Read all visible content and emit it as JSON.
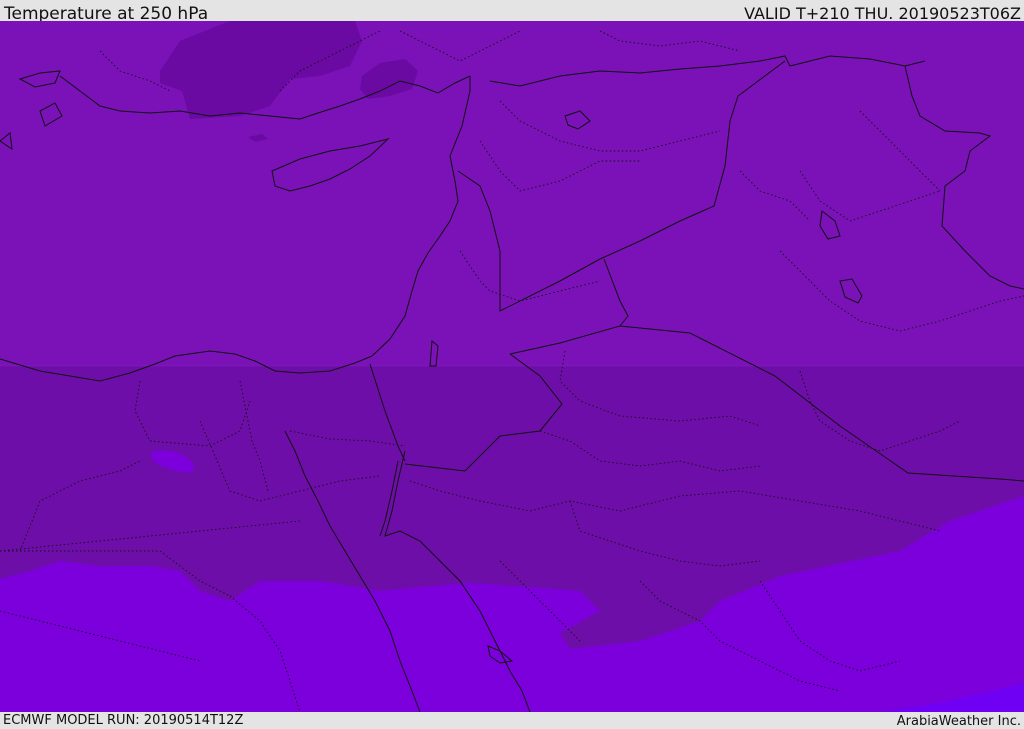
{
  "header": {
    "title": "Temperature at 250 hPa",
    "valid_time": "VALID T+210 THU. 20190523T06Z"
  },
  "footer": {
    "model_run": "ECMWF MODEL RUN: 20190514T12Z",
    "credit": "ArabiaWeather Inc."
  },
  "map": {
    "colors": {
      "base_band": "#7a12b8",
      "cold_band": "#6a0aa2",
      "cool_band": "#6e0ea8",
      "warm_band": "#7c00dc",
      "warmest_band": "#7000f4",
      "border_line": "#111111"
    }
  }
}
